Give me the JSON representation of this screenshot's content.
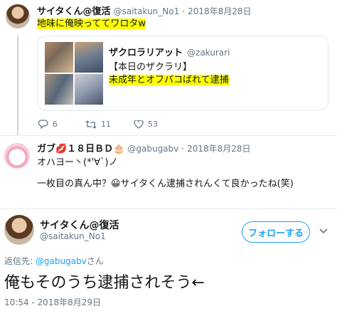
{
  "tweet1": {
    "display_name": "サイタくん@復活",
    "handle": "@saitakun_No1",
    "dot": "·",
    "date": "2018年8月28日",
    "text": "地味に俺映っててワロタw",
    "quote": {
      "display_name": "ザクロラリアット",
      "handle": "@zakurari",
      "line1": "【本日のザクラリ】",
      "line2": "未成年とオフパコばれて逮捕"
    },
    "actions": {
      "reply_count": "6",
      "retweet_count": "11",
      "like_count": "53"
    }
  },
  "tweet2": {
    "display_name": "ガブ💋１８日ＢＤ🎂",
    "handle": "@gabugabv",
    "dot": "·",
    "date": "2018年8月28日",
    "text_line1": "オハヨー丶(*'∀`)ノ",
    "text_line2": "一枚目の真ん中？😀サイタくん逮捕されんくて良かったね(笑)"
  },
  "main_tweet": {
    "display_name": "サイタくん@復活",
    "handle": "@saitakun_No1",
    "follow_label": "フォローする",
    "reply_prefix": "返信先: ",
    "reply_to": "@gabugabv",
    "reply_suffix": "さん",
    "text": "俺もそのうち逮捕されそう←",
    "timestamp": "10:54 - 2018年8月29日"
  },
  "colors": {
    "accent": "#1da1f2",
    "highlight": "#ffff00",
    "muted": "#657786"
  }
}
